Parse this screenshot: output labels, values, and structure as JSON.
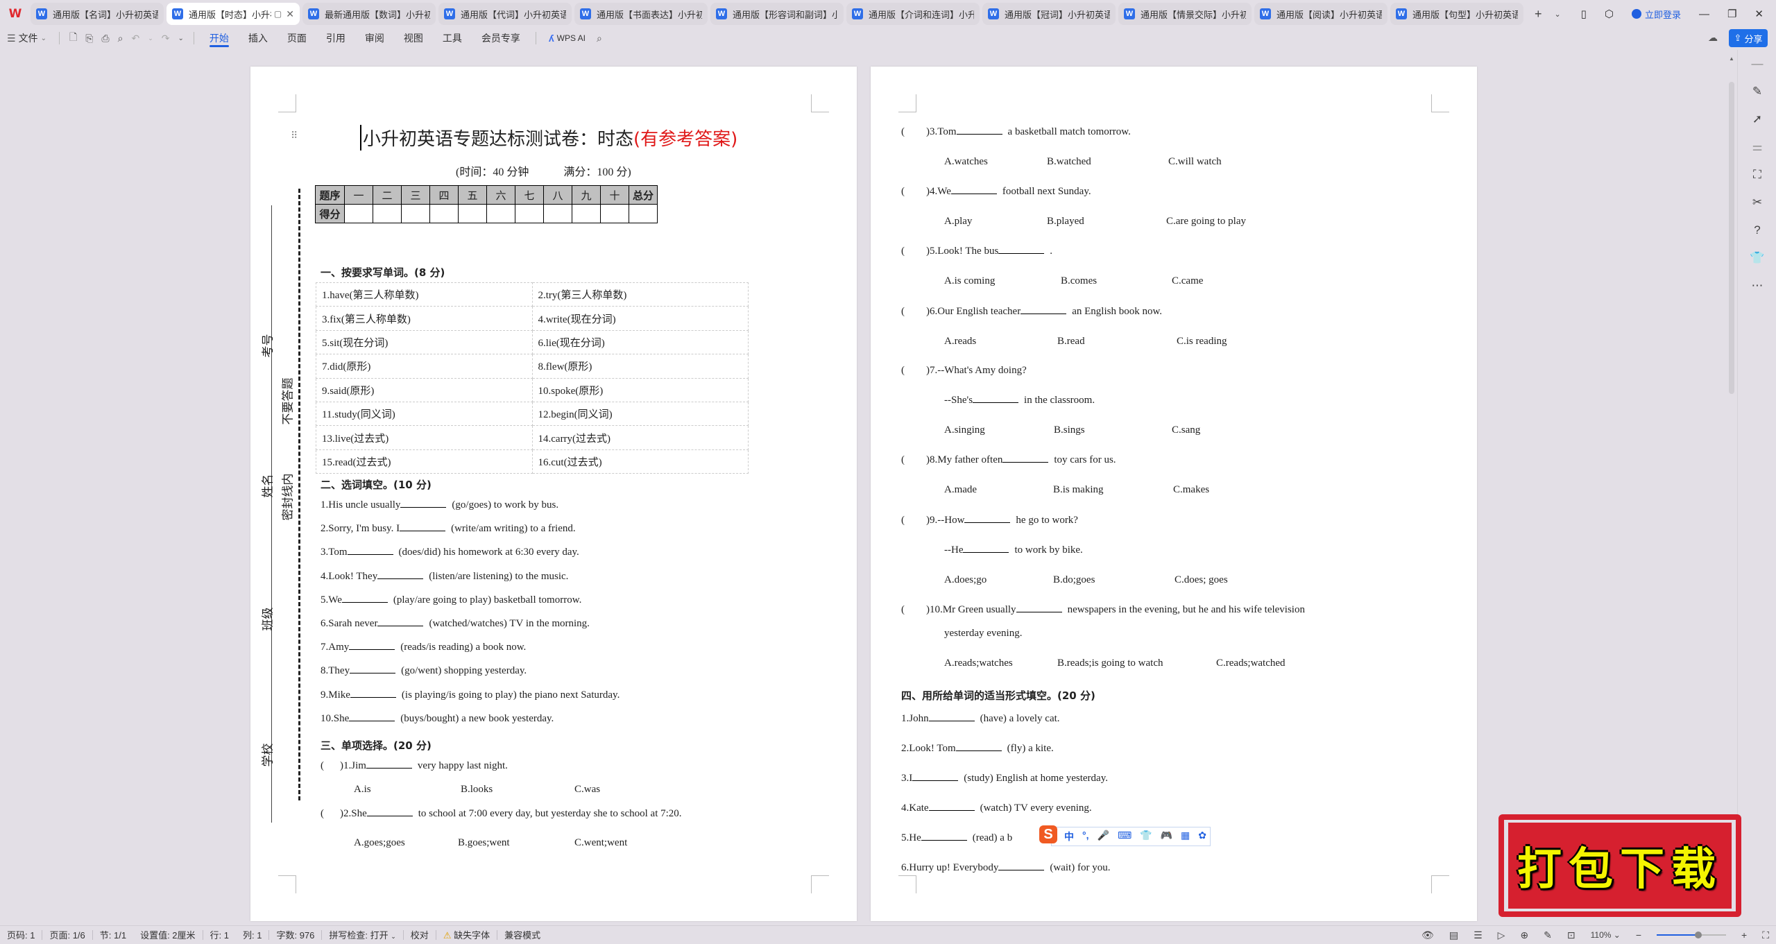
{
  "app": {
    "logo": "W"
  },
  "tabs": [
    {
      "label": "通用版【名词】小升初英语专",
      "active": false
    },
    {
      "label": "通用版【时态】小升初",
      "active": true
    },
    {
      "label": "最新通用版【数词】小升初英",
      "active": false
    },
    {
      "label": "通用版【代词】小升初英语专",
      "active": false
    },
    {
      "label": "通用版【书面表达】小升初英",
      "active": false
    },
    {
      "label": "通用版【形容词和副词】小升",
      "active": false
    },
    {
      "label": "通用版【介词和连词】小升初",
      "active": false
    },
    {
      "label": "通用版【冠词】小升初英语专",
      "active": false
    },
    {
      "label": "通用版【情景交际】小升初英",
      "active": false
    },
    {
      "label": "通用版【阅读】小升初英语专",
      "active": false
    },
    {
      "label": "通用版【句型】小升初英语专",
      "active": false
    }
  ],
  "window": {
    "login": "立即登录",
    "new_tab": "+",
    "minimize": "—",
    "maximize": "❐",
    "close": "✕"
  },
  "ribbon": {
    "file_menu": "文件",
    "tabs": [
      "开始",
      "插入",
      "页面",
      "引用",
      "审阅",
      "视图",
      "工具",
      "会员专享"
    ],
    "active_tab": "开始",
    "ai": "WPS AI",
    "share": "分享"
  },
  "doc": {
    "title_main": "小升初英语专题达标测试卷：时态",
    "title_red": "(有参考答案)",
    "subtitle_time": "(时间：40 分钟",
    "subtitle_score": "满分：100 分)",
    "margin_labels": {
      "kaohao": "考号",
      "xingming": "姓名",
      "banji": "班级",
      "xuexiao": "学校",
      "no_answer": "不要答题",
      "seal": "密封线内"
    },
    "score_table": {
      "header": [
        "题序",
        "一",
        "二",
        "三",
        "四",
        "五",
        "六",
        "七",
        "八",
        "九",
        "十",
        "总分"
      ],
      "row_label": "得分"
    },
    "section1": {
      "title": "一、按要求写单词。(8 分)",
      "items": [
        [
          "1.have(第三人称单数)",
          "2.try(第三人称单数)"
        ],
        [
          "3.fix(第三人称单数)",
          "4.write(现在分词)"
        ],
        [
          "5.sit(现在分词)",
          "6.lie(现在分词)"
        ],
        [
          "7.did(原形)",
          "8.flew(原形)"
        ],
        [
          "9.said(原形)",
          "10.spoke(原形)"
        ],
        [
          "11.study(同义词)",
          "12.begin(同义词)"
        ],
        [
          "13.live(过去式)",
          "14.carry(过去式)"
        ],
        [
          "15.read(过去式)",
          "16.cut(过去式)"
        ]
      ]
    },
    "section2": {
      "title": "二、选词填空。(10 分)",
      "items": [
        {
          "pre": "1.His uncle usually",
          "post": "(go/goes) to work by bus."
        },
        {
          "pre": "2.Sorry, I'm busy. I",
          "post": "(write/am writing) to a friend."
        },
        {
          "pre": "3.Tom",
          "post": "(does/did) his homework at 6:30 every day."
        },
        {
          "pre": "4.Look! They",
          "post": "(listen/are listening) to the music."
        },
        {
          "pre": "5.We",
          "post": "(play/are going to play) basketball tomorrow."
        },
        {
          "pre": "6.Sarah never",
          "post": "(watched/watches) TV in the morning."
        },
        {
          "pre": "7.Amy",
          "post": "(reads/is reading) a book now."
        },
        {
          "pre": "8.They",
          "post": "(go/went) shopping yesterday."
        },
        {
          "pre": "9.Mike",
          "post": "(is playing/is going to play) the piano next Saturday."
        },
        {
          "pre": "10.She",
          "post": "(buys/bought) a new book yesterday."
        }
      ]
    },
    "section3": {
      "title": "三、单项选择。(20 分)",
      "page1_items": [
        {
          "pre": ")1.Jim",
          "post": "very happy last night.",
          "options": [
            "A.is",
            "B.looks",
            "C.was"
          ]
        },
        {
          "pre": ")2.She",
          "post": "to school at 7:00 every day, but yesterday she to school at 7:20.",
          "options": [
            "A.goes;goes",
            "B.goes;went",
            "C.went;went"
          ]
        }
      ],
      "page2_items": [
        {
          "pre": ")3.Tom",
          "post": "a basketball match tomorrow.",
          "options": [
            "A.watches",
            "B.watched",
            "C.will watch"
          ]
        },
        {
          "pre": ")4.We",
          "post": "football next Sunday.",
          "options": [
            "A.play",
            "B.played",
            "C.are going to play"
          ]
        },
        {
          "pre": ")5.Look! The bus",
          "post": ".",
          "options": [
            "A.is coming",
            "B.comes",
            "C.came"
          ]
        },
        {
          "pre": ")6.Our English teacher",
          "post": "an English book now.",
          "options": [
            "A.reads",
            "B.read",
            "C.is reading"
          ]
        },
        {
          "pre": ")7.--What's Amy doing?",
          "post": "",
          "line2_pre": "--She's",
          "line2_post": "in the classroom.",
          "options": [
            "A.singing",
            "B.sings",
            "C.sang"
          ]
        },
        {
          "pre": ")8.My father often",
          "post": "toy cars for us.",
          "options": [
            "A.made",
            "B.is making",
            "C.makes"
          ]
        },
        {
          "pre": ")9.--How",
          "post": "he go to work?",
          "line2_pre": "--He",
          "line2_post": "to work by bike.",
          "options": [
            "A.does;go",
            "B.do;goes",
            "C.does; goes"
          ]
        },
        {
          "pre": ")10.Mr Green usually",
          "post": "newspapers in the evening, but he and his wife television",
          "cont": "yesterday evening.",
          "options": [
            "A.reads;watches",
            "B.reads;is going to watch",
            "C.reads;watched"
          ]
        }
      ]
    },
    "section4": {
      "title": "四、用所给单词的适当形式填空。(20 分)",
      "items": [
        {
          "pre": "1.John",
          "post": "(have) a lovely cat."
        },
        {
          "pre": "2.Look! Tom",
          "post": "(fly) a kite."
        },
        {
          "pre": "3.I",
          "post": "(study) English at home yesterday."
        },
        {
          "pre": "4.Kate",
          "post": "(watch) TV every evening."
        },
        {
          "pre": "5.He",
          "post": "(read) a b"
        },
        {
          "pre": "6.Hurry up! Everybody",
          "post": "(wait) for you."
        }
      ]
    }
  },
  "ime": {
    "logo": "S",
    "items": [
      "中",
      "°,",
      "🎤",
      "⌨",
      "👕",
      "🎮",
      "▦",
      "✿"
    ]
  },
  "promo": {
    "text": "打包下载"
  },
  "status": {
    "page_num": "页码: 1",
    "pages": "页面: 1/6",
    "section": "节: 1/1",
    "setting": "设置值: 2厘米",
    "row": "行: 1",
    "col": "列: 1",
    "words": "字数: 976",
    "spell": "拼写检查: 打开",
    "proof": "校对",
    "missing_font": "缺失字体",
    "compat": "兼容模式",
    "zoom": "110%",
    "zoom_fraction": 0.6
  }
}
